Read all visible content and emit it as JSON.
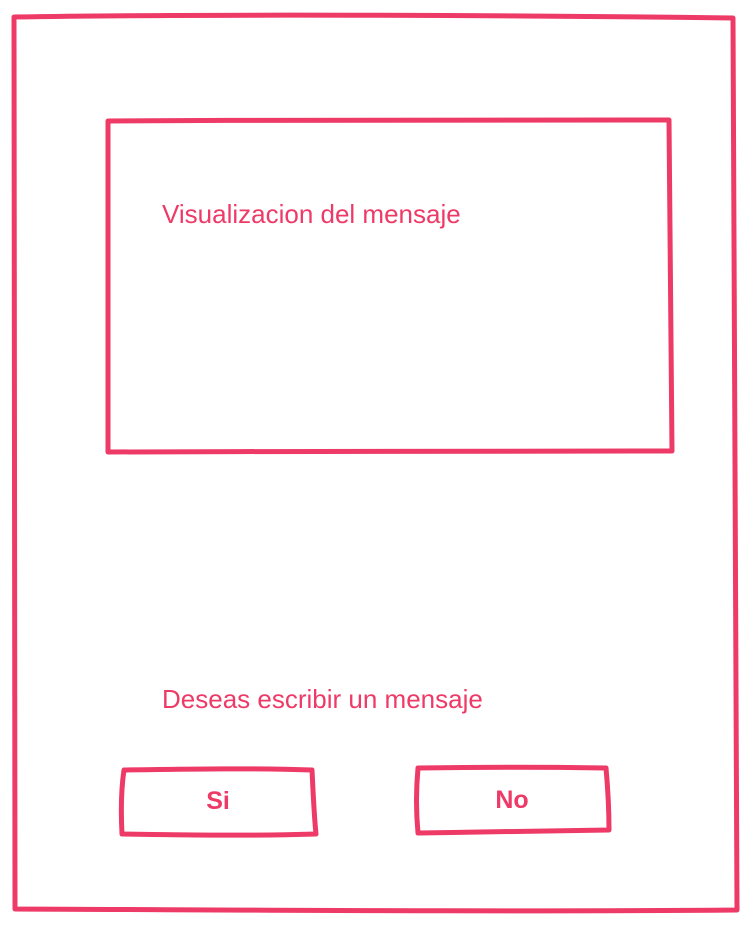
{
  "colors": {
    "accent": "#EE3A67",
    "background": "#FFFFFF"
  },
  "message_panel": {
    "label": "Visualizacion del mensaje"
  },
  "prompt": {
    "label": "Deseas escribir un mensaje"
  },
  "buttons": {
    "yes_label": "Si",
    "no_label": "No"
  }
}
